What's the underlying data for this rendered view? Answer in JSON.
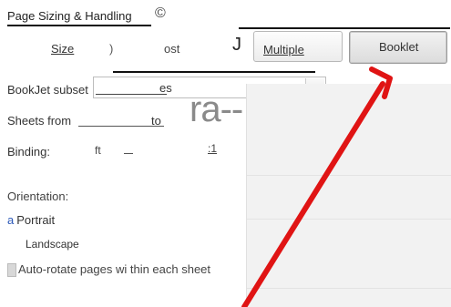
{
  "section": {
    "title": "Page Sizing & Handling",
    "copyright_glyph": "©"
  },
  "sizing_buttons": {
    "size": "Size",
    "glyph1": ")",
    "poster": "ost",
    "glyph2": "J",
    "multiple": "Multiple",
    "booklet": "Booklet"
  },
  "pages": {
    "label": "BookJet subset",
    "value": "es"
  },
  "sheets": {
    "label": "Sheets from",
    "to": "to",
    "big_text": "ra--"
  },
  "binding": {
    "label": "Binding:",
    "value": "ft",
    "misc": ":1"
  },
  "orientation": {
    "label": "Orientation:",
    "portrait_marker": "a",
    "portrait": "Portrait",
    "landscape": "Landscape"
  },
  "autorotate": {
    "label": "Auto-rotate pages wi thin each sheet"
  },
  "colors": {
    "annotation_arrow": "#e01414",
    "selected_button": "#dcdcdc"
  },
  "icons": {
    "dropdown": "chevron-down-icon",
    "annotation": "red-arrow-icon"
  }
}
